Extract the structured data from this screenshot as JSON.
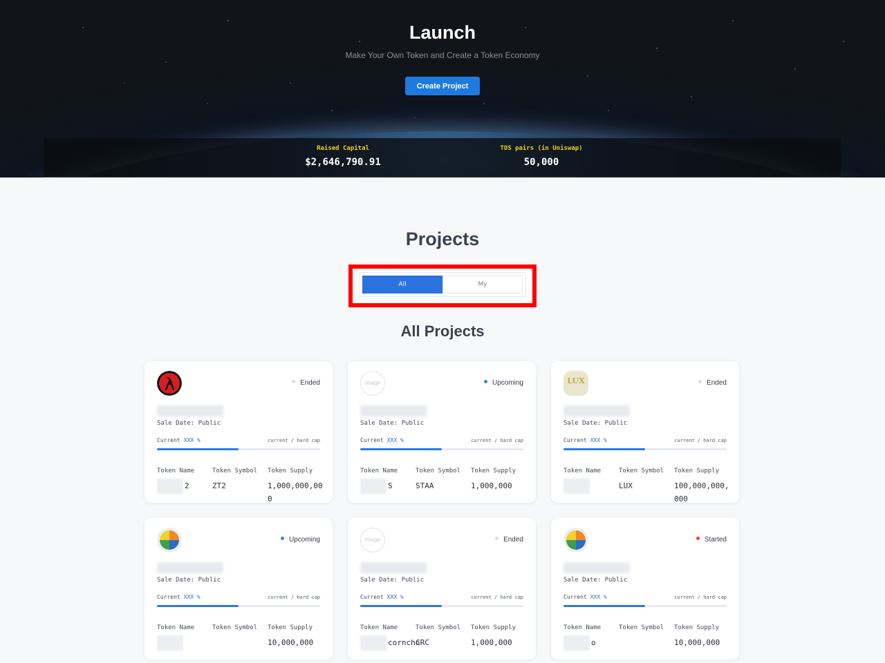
{
  "hero": {
    "title": "Launch",
    "subtitle": "Make Your Own Token and Create a Token Economy",
    "create_button": "Create Project",
    "stats": [
      {
        "label": "Raised Capital",
        "value": "$2,646,790.91"
      },
      {
        "label": "TOS pairs (in Uniswap)",
        "value": "50,000"
      }
    ]
  },
  "projects": {
    "title": "Projects",
    "tabs": [
      {
        "label": "All",
        "active": true
      },
      {
        "label": "My",
        "active": false
      }
    ],
    "subtitle": "All Projects"
  },
  "card_labels": {
    "sale_date": "Sale Date:  Public",
    "current": "Current",
    "current_pct": "XXX %",
    "cap": "current / hard cap",
    "token_name": "Token Name",
    "token_symbol": "Token Symbol",
    "token_supply": "Token Supply"
  },
  "cards": [
    {
      "status": "Ended",
      "status_color": "#d9dce1",
      "logo": "red-figure-logo",
      "token_name": "2",
      "token_symbol": "ZT2",
      "token_supply": "1,000,000,000",
      "progress": 0.5
    },
    {
      "status": "Upcoming",
      "status_color": "#2a8ae8",
      "logo": "image-placeholder",
      "token_name": "S",
      "token_symbol": "STAA",
      "token_supply": "1,000,000",
      "progress": 0.5
    },
    {
      "status": "Ended",
      "status_color": "#d9dce1",
      "logo": "lux-logo",
      "token_name": "",
      "token_symbol": "LUX",
      "token_supply": "100,000,000,000",
      "progress": 0.5
    },
    {
      "status": "Upcoming",
      "status_color": "#2a8ae8",
      "logo": "color-wheel-logo",
      "token_name": "",
      "token_symbol": "",
      "token_supply": "10,000,000",
      "progress": 0.5
    },
    {
      "status": "Ended",
      "status_color": "#d9dce1",
      "logo": "image-placeholder",
      "token_name": "corncho",
      "token_symbol": "CRC",
      "token_supply": "1,000,000",
      "progress": 0.5
    },
    {
      "status": "Started",
      "status_color": "#f04438",
      "logo": "color-wheel-logo",
      "token_name": "o",
      "token_symbol": "",
      "token_supply": "10,000,000",
      "progress": 0.5
    }
  ],
  "image_placeholder_text": "Image",
  "lux_logo_text": "LUX"
}
